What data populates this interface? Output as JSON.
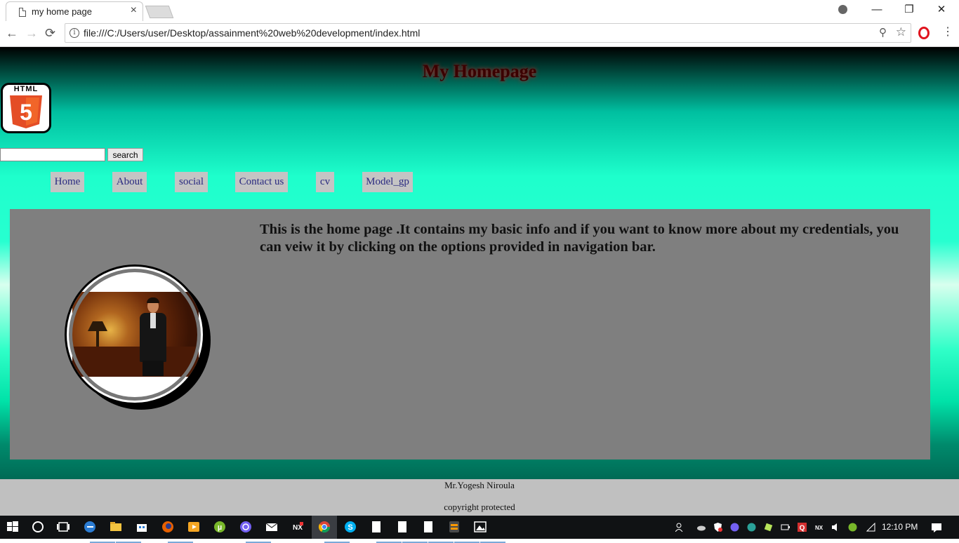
{
  "browser": {
    "tab_title": "my home page",
    "tab_close": "×",
    "url": "file:///C:/Users/user/Desktop/assainment%20web%20development/index.html",
    "back": "←",
    "forward": "→",
    "reload": "⟳",
    "zoom_glyph": "⚲",
    "star_glyph": "☆",
    "menu_glyph": "⋮",
    "minimize": "—",
    "restore": "❐",
    "close": "✕"
  },
  "page": {
    "heading": "My Homepage",
    "logo_text": "HTML",
    "logo_badge": "5",
    "search_placeholder": "",
    "search_button": "search",
    "nav": [
      "Home",
      "About",
      "social",
      "Contact us",
      "cv",
      "Model_gp"
    ],
    "intro": "This is the home page .It contains my basic info and if you want to know more about my credentials, you can veiw it by clicking on the options provided in navigation bar.",
    "footer_name": "Mr.Yogesh Niroula",
    "footer_copyright": "copyright protected"
  },
  "taskbar": {
    "clock": "12:10 PM",
    "icons": [
      "windows-start-icon",
      "search-circle-icon",
      "task-view-icon",
      "edge-icon",
      "file-explorer-icon",
      "store-icon",
      "firefox-icon",
      "media-player-icon",
      "utorrent-icon",
      "viber-icon",
      "mail-icon",
      "nx-icon",
      "chrome-icon",
      "skype-icon",
      "document-icon",
      "document-icon",
      "document-icon",
      "sublime-icon",
      "photos-icon"
    ]
  },
  "colors": {
    "content_bg": "#7f7f7f",
    "footer_bg": "#c0c0c0",
    "nav_bg": "#c4c4c4",
    "heading_color": "#3a0000"
  }
}
